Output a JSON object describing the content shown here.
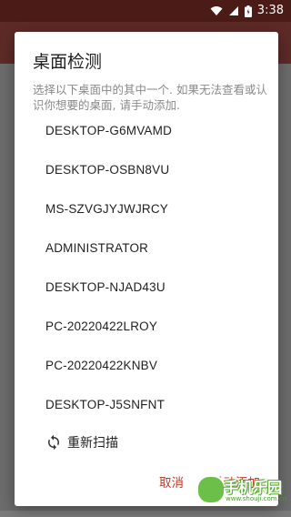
{
  "status_bar": {
    "time": "3:38",
    "icons": [
      "wifi-icon",
      "signal-icon",
      "battery-icon"
    ]
  },
  "dialog": {
    "title": "桌面检测",
    "description": "选择以下桌面中的其中一个. 如果无法查看或认识你想要的桌面, 请手动添加.",
    "devices": [
      "DESKTOP-G6MVAMD",
      "DESKTOP-OSBN8VU",
      "MS-SZVGJYJWJRCY",
      "ADMINISTRATOR",
      "DESKTOP-NJAD43U",
      "PC-20220422LROY",
      "PC-20220422KNBV",
      "DESKTOP-J5SNFNT"
    ],
    "rescan_label": "重新扫描",
    "cancel_label": "取消",
    "manual_add_label": "手动添加"
  },
  "watermark": {
    "text": "手机乐园",
    "url": "www.shouji.com.cn"
  },
  "colors": {
    "status_bar": "#4b1b18",
    "app_bar": "#5d2a27",
    "accent": "#c0392b",
    "watermark": "#6cc04a"
  }
}
